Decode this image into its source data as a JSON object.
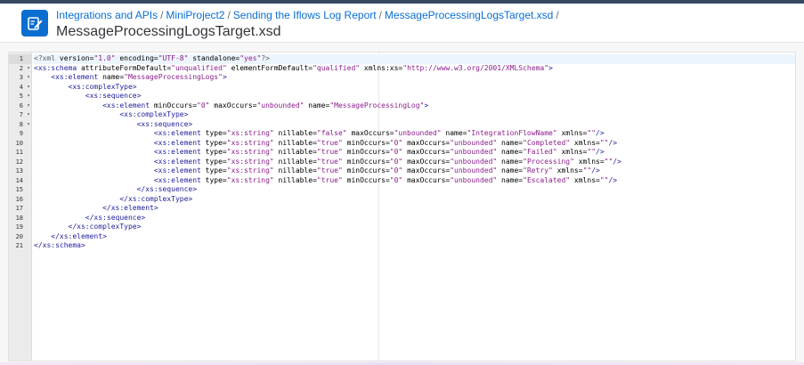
{
  "colors": {
    "shell_bar": "#354a5f",
    "link": "#0a6ed1",
    "tag": "#1e1e9c",
    "attr_value": "#8a1d8a",
    "active_line": "#edf5fc"
  },
  "header": {
    "icon": "integration-package-icon",
    "breadcrumb": [
      {
        "label": "Integrations and APIs"
      },
      {
        "label": "MiniProject2"
      },
      {
        "label": "Sending the Iflows Log Report"
      },
      {
        "label": "MessageProcessingLogsTarget.xsd"
      }
    ],
    "separator": "/",
    "title": "MessageProcessingLogsTarget.xsd"
  },
  "editor": {
    "active_line": 1,
    "lines": [
      {
        "n": "1",
        "fold": false,
        "indent": "",
        "tokens": [
          [
            "pi",
            "<?xml "
          ],
          [
            "attr",
            "version="
          ],
          [
            "val",
            "\"1.0\""
          ],
          [
            "attr",
            " encoding="
          ],
          [
            "val",
            "\"UTF-8\""
          ],
          [
            "attr",
            " standalone="
          ],
          [
            "val",
            "\"yes\""
          ],
          [
            "pi",
            "?>"
          ]
        ]
      },
      {
        "n": "2",
        "fold": true,
        "indent": "",
        "tokens": [
          [
            "tag",
            "<xs:schema"
          ],
          [
            "attr",
            " attributeFormDefault="
          ],
          [
            "val",
            "\"unqualified\""
          ],
          [
            "attr",
            " elementFormDefault="
          ],
          [
            "val",
            "\"qualified\""
          ],
          [
            "attr",
            " xmlns:xs="
          ],
          [
            "val",
            "\"http://www.w3.org/2001/XMLSchema\""
          ],
          [
            "tag",
            ">"
          ]
        ]
      },
      {
        "n": "3",
        "fold": true,
        "indent": "    ",
        "tokens": [
          [
            "tag",
            "<xs:element"
          ],
          [
            "attr",
            " name="
          ],
          [
            "val",
            "\"MessageProcessingLogs\""
          ],
          [
            "tag",
            ">"
          ]
        ]
      },
      {
        "n": "4",
        "fold": true,
        "indent": "        ",
        "tokens": [
          [
            "tag",
            "<xs:complexType>"
          ]
        ]
      },
      {
        "n": "5",
        "fold": true,
        "indent": "            ",
        "tokens": [
          [
            "tag",
            "<xs:sequence>"
          ]
        ]
      },
      {
        "n": "6",
        "fold": true,
        "indent": "                ",
        "tokens": [
          [
            "tag",
            "<xs:element"
          ],
          [
            "attr",
            " minOccurs="
          ],
          [
            "val",
            "\"0\""
          ],
          [
            "attr",
            " maxOccurs="
          ],
          [
            "val",
            "\"unbounded\""
          ],
          [
            "attr",
            " name="
          ],
          [
            "val",
            "\"MessageProcessingLog\""
          ],
          [
            "tag",
            ">"
          ]
        ]
      },
      {
        "n": "7",
        "fold": true,
        "indent": "                    ",
        "tokens": [
          [
            "tag",
            "<xs:complexType>"
          ]
        ]
      },
      {
        "n": "8",
        "fold": true,
        "indent": "                        ",
        "tokens": [
          [
            "tag",
            "<xs:sequence>"
          ]
        ]
      },
      {
        "n": "9",
        "fold": false,
        "indent": "                            ",
        "tokens": [
          [
            "tag",
            "<xs:element"
          ],
          [
            "attr",
            " type="
          ],
          [
            "val",
            "\"xs:string\""
          ],
          [
            "attr",
            " nillable="
          ],
          [
            "val",
            "\"false\""
          ],
          [
            "attr",
            " maxOccurs="
          ],
          [
            "val",
            "\"unbounded\""
          ],
          [
            "attr",
            " name="
          ],
          [
            "val",
            "\"IntegrationFlowName\""
          ],
          [
            "attr",
            " xmlns="
          ],
          [
            "val",
            "\"\""
          ],
          [
            "tag",
            "/>"
          ]
        ]
      },
      {
        "n": "10",
        "fold": false,
        "indent": "                            ",
        "tokens": [
          [
            "tag",
            "<xs:element"
          ],
          [
            "attr",
            " type="
          ],
          [
            "val",
            "\"xs:string\""
          ],
          [
            "attr",
            " nillable="
          ],
          [
            "val",
            "\"true\""
          ],
          [
            "attr",
            " minOccurs="
          ],
          [
            "val",
            "\"0\""
          ],
          [
            "attr",
            " maxOccurs="
          ],
          [
            "val",
            "\"unbounded\""
          ],
          [
            "attr",
            " name="
          ],
          [
            "val",
            "\"Completed\""
          ],
          [
            "attr",
            " xmlns="
          ],
          [
            "val",
            "\"\""
          ],
          [
            "tag",
            "/>"
          ]
        ]
      },
      {
        "n": "11",
        "fold": false,
        "indent": "                            ",
        "tokens": [
          [
            "tag",
            "<xs:element"
          ],
          [
            "attr",
            " type="
          ],
          [
            "val",
            "\"xs:string\""
          ],
          [
            "attr",
            " nillable="
          ],
          [
            "val",
            "\"true\""
          ],
          [
            "attr",
            " minOccurs="
          ],
          [
            "val",
            "\"0\""
          ],
          [
            "attr",
            " maxOccurs="
          ],
          [
            "val",
            "\"unbounded\""
          ],
          [
            "attr",
            " name="
          ],
          [
            "val",
            "\"Failed\""
          ],
          [
            "attr",
            " xmlns="
          ],
          [
            "val",
            "\"\""
          ],
          [
            "tag",
            "/>"
          ]
        ]
      },
      {
        "n": "12",
        "fold": false,
        "indent": "                            ",
        "tokens": [
          [
            "tag",
            "<xs:element"
          ],
          [
            "attr",
            " type="
          ],
          [
            "val",
            "\"xs:string\""
          ],
          [
            "attr",
            " nillable="
          ],
          [
            "val",
            "\"true\""
          ],
          [
            "attr",
            " minOccurs="
          ],
          [
            "val",
            "\"0\""
          ],
          [
            "attr",
            " maxOccurs="
          ],
          [
            "val",
            "\"unbounded\""
          ],
          [
            "attr",
            " name="
          ],
          [
            "val",
            "\"Processing\""
          ],
          [
            "attr",
            " xmlns="
          ],
          [
            "val",
            "\"\""
          ],
          [
            "tag",
            "/>"
          ]
        ]
      },
      {
        "n": "13",
        "fold": false,
        "indent": "                            ",
        "tokens": [
          [
            "tag",
            "<xs:element"
          ],
          [
            "attr",
            " type="
          ],
          [
            "val",
            "\"xs:string\""
          ],
          [
            "attr",
            " nillable="
          ],
          [
            "val",
            "\"true\""
          ],
          [
            "attr",
            " minOccurs="
          ],
          [
            "val",
            "\"0\""
          ],
          [
            "attr",
            " maxOccurs="
          ],
          [
            "val",
            "\"unbounded\""
          ],
          [
            "attr",
            " name="
          ],
          [
            "val",
            "\"Retry\""
          ],
          [
            "attr",
            " xmlns="
          ],
          [
            "val",
            "\"\""
          ],
          [
            "tag",
            "/>"
          ]
        ]
      },
      {
        "n": "14",
        "fold": false,
        "indent": "                            ",
        "tokens": [
          [
            "tag",
            "<xs:element"
          ],
          [
            "attr",
            " type="
          ],
          [
            "val",
            "\"xs:string\""
          ],
          [
            "attr",
            " nillable="
          ],
          [
            "val",
            "\"true\""
          ],
          [
            "attr",
            " minOccurs="
          ],
          [
            "val",
            "\"0\""
          ],
          [
            "attr",
            " maxOccurs="
          ],
          [
            "val",
            "\"unbounded\""
          ],
          [
            "attr",
            " name="
          ],
          [
            "val",
            "\"Escalated\""
          ],
          [
            "attr",
            " xmlns="
          ],
          [
            "val",
            "\"\""
          ],
          [
            "tag",
            "/>"
          ]
        ]
      },
      {
        "n": "15",
        "fold": false,
        "indent": "                        ",
        "tokens": [
          [
            "tag",
            "</xs:sequence>"
          ]
        ]
      },
      {
        "n": "16",
        "fold": false,
        "indent": "                    ",
        "tokens": [
          [
            "tag",
            "</xs:complexType>"
          ]
        ]
      },
      {
        "n": "17",
        "fold": false,
        "indent": "                ",
        "tokens": [
          [
            "tag",
            "</xs:element>"
          ]
        ]
      },
      {
        "n": "18",
        "fold": false,
        "indent": "            ",
        "tokens": [
          [
            "tag",
            "</xs:sequence>"
          ]
        ]
      },
      {
        "n": "19",
        "fold": false,
        "indent": "        ",
        "tokens": [
          [
            "tag",
            "</xs:complexType>"
          ]
        ]
      },
      {
        "n": "20",
        "fold": false,
        "indent": "    ",
        "tokens": [
          [
            "tag",
            "</xs:element>"
          ]
        ]
      },
      {
        "n": "21",
        "fold": false,
        "indent": "",
        "tokens": [
          [
            "tag",
            "</xs:schema>"
          ]
        ]
      }
    ]
  }
}
